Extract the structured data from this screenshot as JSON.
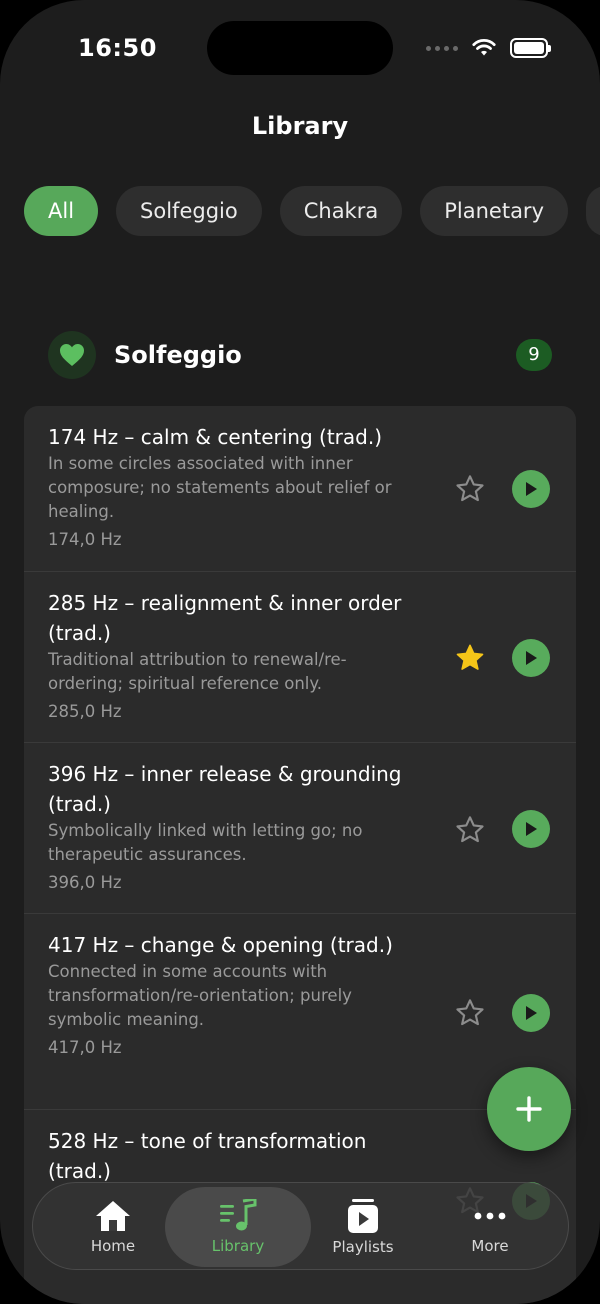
{
  "status": {
    "time": "16:50"
  },
  "header": {
    "title": "Library"
  },
  "chips": [
    "All",
    "Solfeggio",
    "Chakra",
    "Planetary"
  ],
  "section": {
    "title": "Solfeggio",
    "count": "9"
  },
  "items": [
    {
      "title": "174 Hz – calm & centering (trad.)",
      "desc": "In some circles associated with inner composure; no statements about relief or healing.",
      "hz": "174,0 Hz",
      "favorite": false
    },
    {
      "title": "285 Hz – realignment & inner order (trad.)",
      "desc": "Traditional attribution to renewal/re-ordering; spiritual reference only.",
      "hz": "285,0 Hz",
      "favorite": true
    },
    {
      "title": "396 Hz – inner release & grounding (trad.)",
      "desc": "Symbolically linked with letting go; no therapeutic assurances.",
      "hz": "396,0 Hz",
      "favorite": false
    },
    {
      "title": "417 Hz – change & opening (trad.)",
      "desc": "Connected in some accounts with transformation/re-orientation; purely symbolic meaning.",
      "hz": "417,0 Hz",
      "favorite": false
    },
    {
      "title": "528 Hz – tone of transformation (trad.)",
      "desc": "",
      "hz": "",
      "favorite": false
    }
  ],
  "tabs": [
    {
      "label": "Home",
      "icon": "home-icon"
    },
    {
      "label": "Library",
      "icon": "music-list-icon"
    },
    {
      "label": "Playlists",
      "icon": "playlist-play-icon"
    },
    {
      "label": "More",
      "icon": "more-icon"
    }
  ],
  "colors": {
    "accent": "#57a85a",
    "favorite": "#f5c518",
    "background": "#1d1d1d",
    "card": "#2b2b2b"
  }
}
